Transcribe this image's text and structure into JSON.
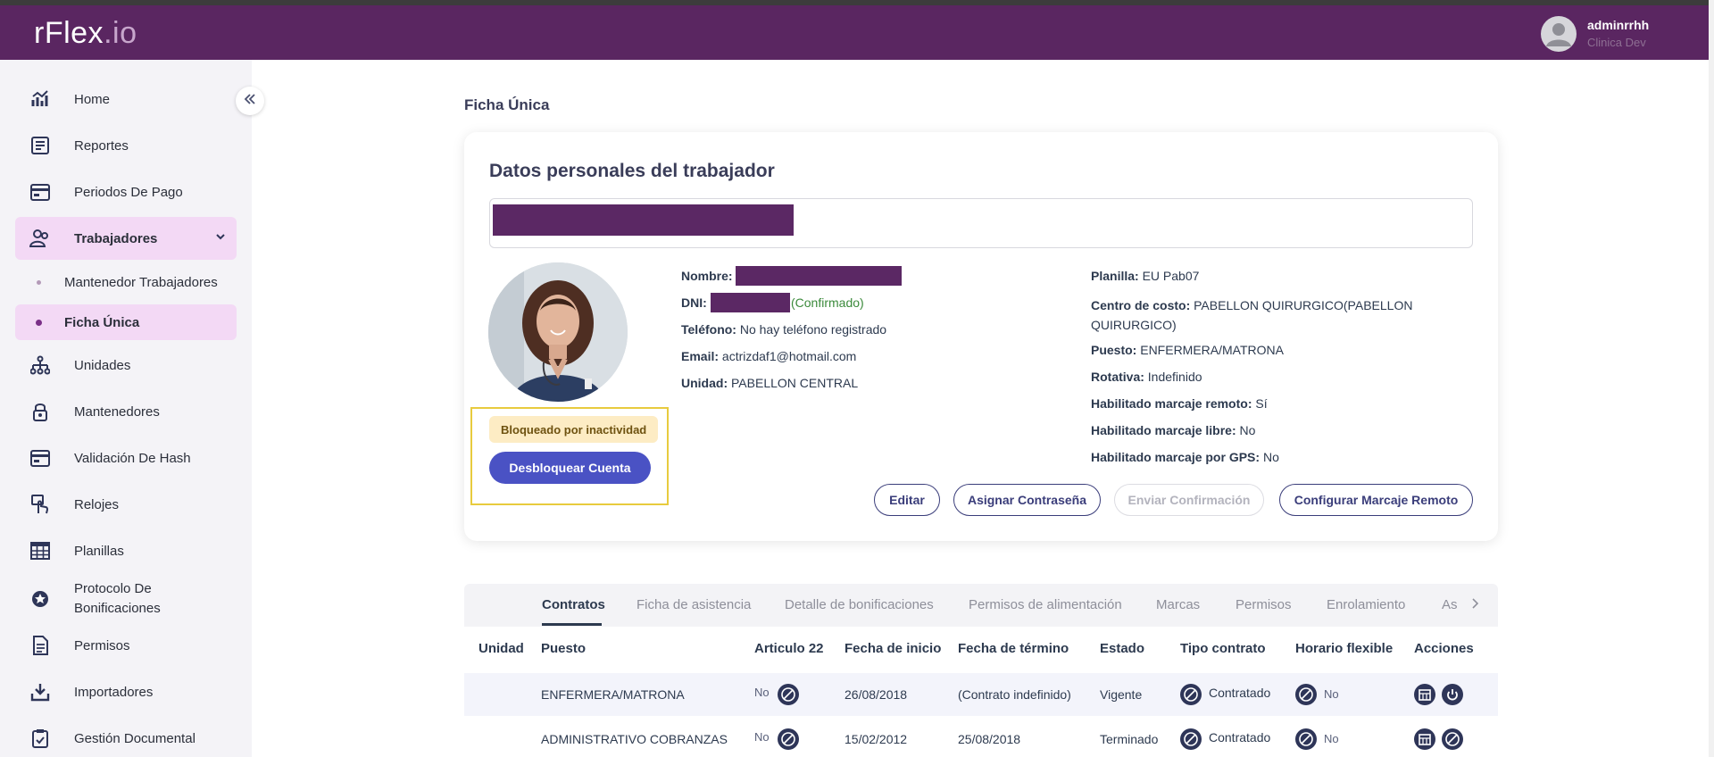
{
  "header": {
    "logo_main": "rFlex",
    "logo_suffix": ".io",
    "user_name": "adminrrhh",
    "user_org": "Clinica Dev"
  },
  "sidebar": {
    "items": [
      {
        "label": "Home",
        "icon": "chart-icon"
      },
      {
        "label": "Reportes",
        "icon": "report-icon"
      },
      {
        "label": "Periodos De Pago",
        "icon": "calendar-card-icon"
      },
      {
        "label": "Trabajadores",
        "icon": "users-icon",
        "active": true
      },
      {
        "label": "Unidades",
        "icon": "org-tree-icon"
      },
      {
        "label": "Mantenedores",
        "icon": "lock-icon"
      },
      {
        "label": "Validación De Hash",
        "icon": "card-icon"
      },
      {
        "label": "Relojes",
        "icon": "touch-icon"
      },
      {
        "label": "Planillas",
        "icon": "grid-icon"
      },
      {
        "label_line1": "Protocolo De",
        "label_line2": "Bonificaciones",
        "icon": "badge-star-icon"
      },
      {
        "label": "Permisos",
        "icon": "document-icon"
      },
      {
        "label": "Importadores",
        "icon": "download-icon"
      },
      {
        "label": "Gestión Documental",
        "icon": "checklist-icon"
      }
    ],
    "sub_items": [
      {
        "label": "Mantenedor Trabajadores"
      },
      {
        "label": "Ficha Única",
        "active": true
      }
    ]
  },
  "main": {
    "page_title": "Ficha Única",
    "card_title": "Datos personales del trabajador",
    "status_badge": "Bloqueado por inactividad",
    "unlock_button": "Desbloquear Cuenta",
    "left_info": {
      "nombre_label": "Nombre:",
      "dni_label": "DNI:",
      "dni_status": "(Confirmado)",
      "telefono_label": "Teléfono:",
      "telefono_value": "No hay teléfono registrado",
      "email_label": "Email:",
      "email_value": "actrizdaf1@hotmail.com",
      "unidad_label": "Unidad:",
      "unidad_value": "PABELLON CENTRAL"
    },
    "right_info": {
      "planilla_label": "Planilla:",
      "planilla_value": "EU Pab07",
      "centro_label": "Centro de costo:",
      "centro_value_line1": "PABELLON QUIRURGICO(PABELLON",
      "centro_value_line2": "QUIRURGICO)",
      "puesto_label": "Puesto:",
      "puesto_value": "ENFERMERA/MATRONA",
      "rotativa_label": "Rotativa:",
      "rotativa_value": "Indefinido",
      "remoto_label": "Habilitado marcaje remoto:",
      "remoto_value": "Sí",
      "libre_label": "Habilitado marcaje libre:",
      "libre_value": "No",
      "gps_label": "Habilitado marcaje por GPS:",
      "gps_value": "No"
    },
    "actions": {
      "edit": "Editar",
      "password": "Asignar Contraseña",
      "send_confirm": "Enviar Confirmación",
      "remote": "Configurar Marcaje Remoto"
    },
    "tabs": [
      "Contratos",
      "Ficha de asistencia",
      "Detalle de bonificaciones",
      "Permisos de alimentación",
      "Marcas",
      "Permisos",
      "Enrolamiento",
      "As"
    ],
    "table": {
      "headers": [
        "Unidad",
        "Puesto",
        "Articulo 22",
        "Fecha de inicio",
        "Fecha de término",
        "Estado",
        "Tipo contrato",
        "Horario flexible",
        "Acciones"
      ],
      "rows": [
        {
          "unidad": "",
          "puesto": "ENFERMERA/MATRONA",
          "articulo22": "No",
          "inicio": "26/08/2018",
          "termino": "(Contrato indefinido)",
          "estado": "Vigente",
          "tipo": "Contratado",
          "flexible": "No"
        },
        {
          "unidad": "",
          "puesto": "ADMINISTRATIVO COBRANZAS",
          "articulo22": "No",
          "inicio": "15/02/2012",
          "termino": "25/08/2018",
          "estado": "Terminado",
          "tipo": "Contratado",
          "flexible": "No"
        }
      ]
    }
  },
  "colors": {
    "header": "#5a2661",
    "accent_button": "#4a52c4",
    "active_nav": "#f3d9f5",
    "badge_bg": "#fdecc4",
    "highlight_border": "#e8cb3e"
  }
}
